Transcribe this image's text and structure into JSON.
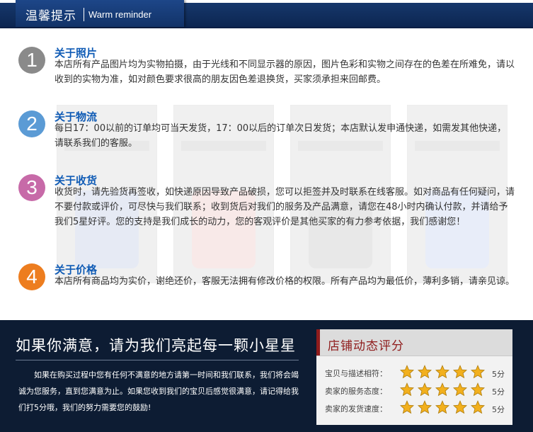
{
  "header": {
    "title": "温馨提示",
    "subtitle": "Warm reminder"
  },
  "colors": {
    "header_bg": "#0c2651",
    "item1": "#8a8a8a",
    "item2": "#5b9bd5",
    "item3": "#c76aa8",
    "item4": "#ed7d1f",
    "title_blue": "#0f5bb5",
    "footer_bg": "#0d1c33",
    "rating_title": "#8f1c1c",
    "star": "#f2b01e"
  },
  "items": [
    {
      "number": "1",
      "title": "关于照片",
      "body": "本店所有产品图片均为实物拍摄，由于光线和不同显示器的原因，图片色彩和实物之间存在的色差在所难免，请以收到的实物为准，如对颜色要求很高的朋友因色差退换货，买家须承担来回邮费。"
    },
    {
      "number": "2",
      "title": "关于物流",
      "body": "每日17：00以前的订单均可当天发货，17：00以后的订单次日发货；本店默认发申通快递，如需发其他快递，请联系我们的客服。"
    },
    {
      "number": "3",
      "title": "关于收货",
      "body": "收货时，请先验货再签收，如快递原因导致产品破损，您可以拒签并及时联系在线客服。如对商品有任何疑问，请不要付款或评价，可尽快与我们联系；收到货后对我们的服务及产品满意，请您在48小时内确认付款，并请给予我们5星好评。您的支持是我们成长的动力，您的客观评价是其他买家的有力参考依据，我们感谢您！"
    },
    {
      "number": "4",
      "title": "关于价格",
      "body": "本店所有商品均为实价，谢绝还价，客服无法拥有修改价格的权限。所有产品均为最低价，薄利多销，请亲见谅。"
    }
  ],
  "footer": {
    "slogan": "如果你满意，请为我们亮起每一颗小星星",
    "text": "如果在购买过程中您有任何不满意的地方请第一时间和我们联系，我们将会竭诚为您服务，直到您满意为止。如果您收到我们的宝贝后感觉很满意，请记得给我们打5分哦，我们的努力需要您的鼓励!"
  },
  "rating": {
    "title": "店铺动态评分",
    "rows": [
      {
        "label": "宝贝与描述相符：",
        "stars": 5,
        "score": "5分"
      },
      {
        "label": "卖家的服务态度：",
        "stars": 5,
        "score": "5分"
      },
      {
        "label": "卖家的发货速度：",
        "stars": 5,
        "score": "5分"
      }
    ]
  }
}
